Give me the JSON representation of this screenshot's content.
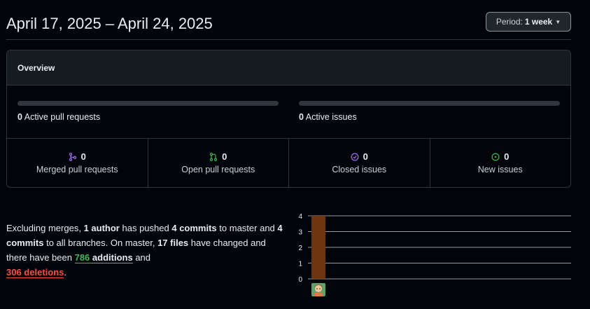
{
  "header": {
    "date_range": "April 17, 2025 – April 24, 2025",
    "period_prefix": "Period:",
    "period_value": "1 week"
  },
  "overview": {
    "title": "Overview",
    "active_prs": {
      "count": "0",
      "label": "Active pull requests",
      "progress": 0
    },
    "active_issues": {
      "count": "0",
      "label": "Active issues",
      "progress": 0
    },
    "stats": [
      {
        "count": "0",
        "label": "Merged pull requests",
        "icon": "merge-icon",
        "color": "#a371f7"
      },
      {
        "count": "0",
        "label": "Open pull requests",
        "icon": "pull-request-icon",
        "color": "#3fb950"
      },
      {
        "count": "0",
        "label": "Closed issues",
        "icon": "check-circle-icon",
        "color": "#a371f7"
      },
      {
        "count": "0",
        "label": "New issues",
        "icon": "issue-opened-icon",
        "color": "#3fb950"
      }
    ]
  },
  "summary": {
    "p1": "Excluding merges,",
    "authors": "1 author",
    "p2": "has pushed",
    "commits_master": "4 commits",
    "p3": "to master and",
    "commits_all": "4 commits",
    "p4": "to all branches. On master,",
    "files": "17 files",
    "p5": "have changed and there have been",
    "additions_num": "786",
    "additions_word": "additions",
    "p6": "and",
    "deletions": "306 deletions",
    "p7": "."
  },
  "chart_data": {
    "type": "bar",
    "categories": [
      ""
    ],
    "values": [
      4
    ],
    "ylim": [
      0,
      4
    ],
    "yticks": [
      "0",
      "1",
      "2",
      "3",
      "4"
    ],
    "bar_color": "#6e3511",
    "grid": true
  }
}
